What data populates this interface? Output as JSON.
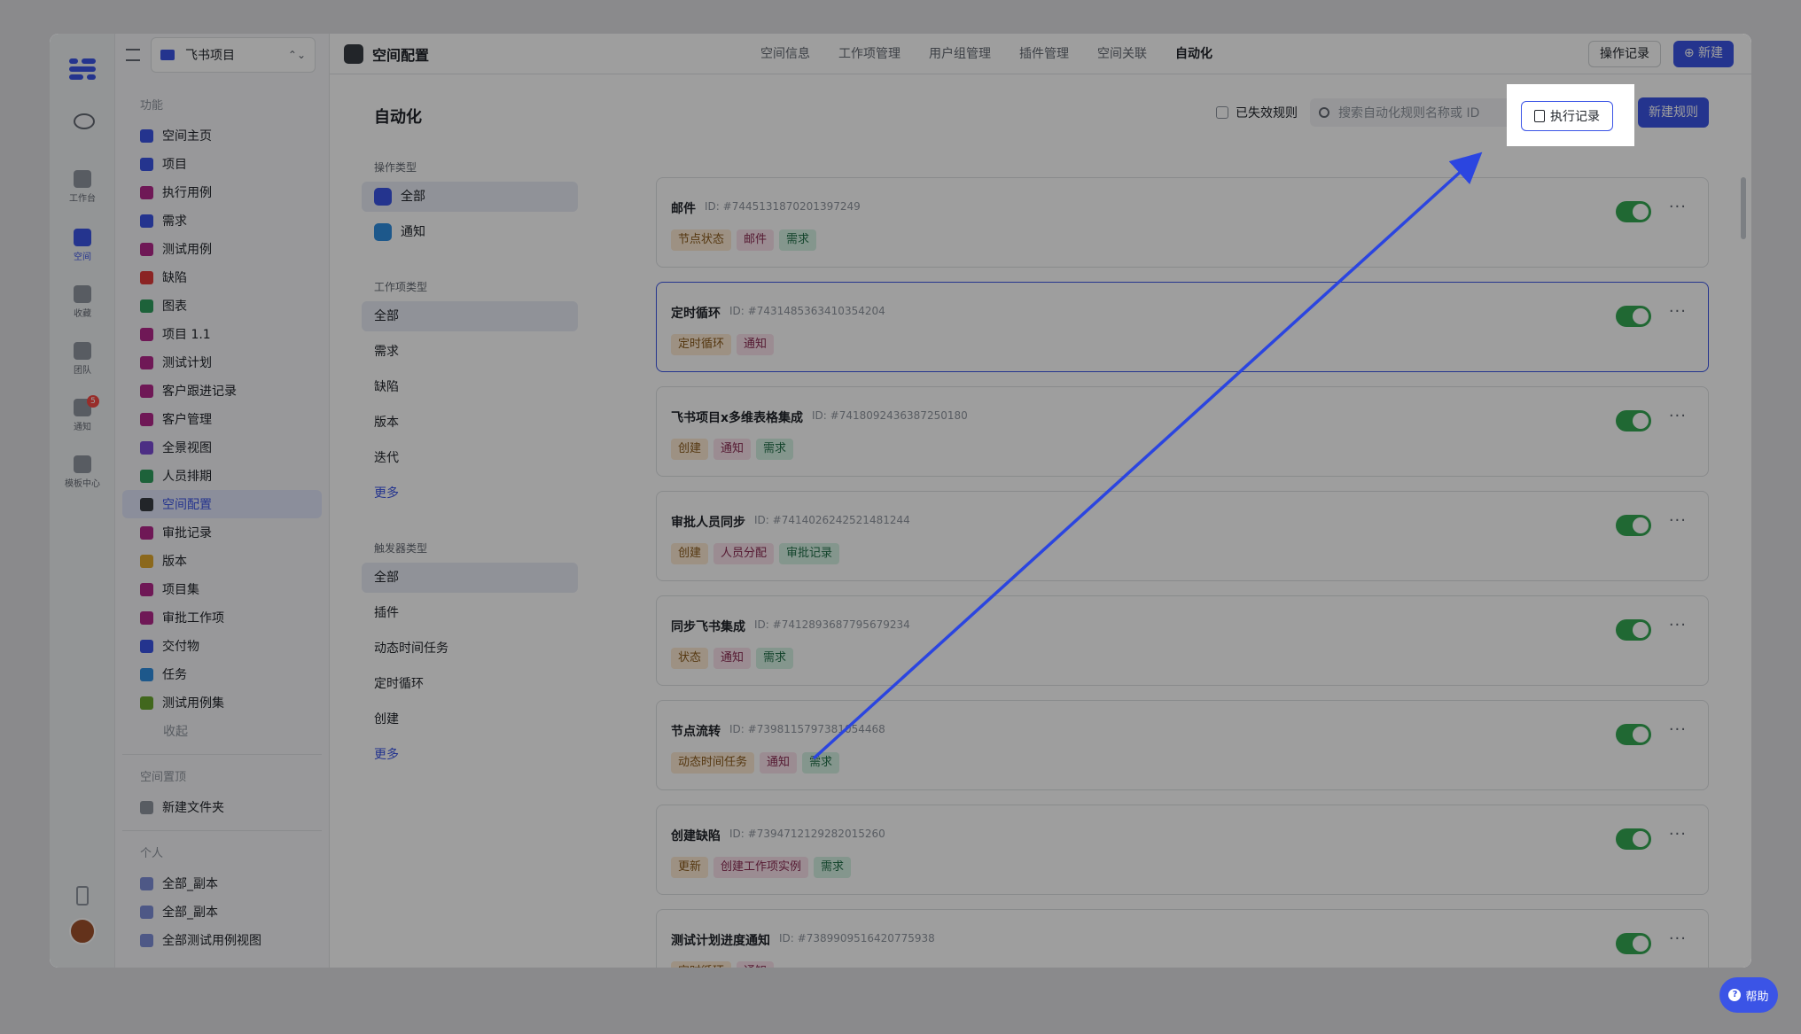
{
  "nav": {
    "project": "飞书项目",
    "section_features": "功能",
    "items": [
      {
        "label": "空间主页",
        "color": "#3b54e6"
      },
      {
        "label": "项目",
        "color": "#3b54e6"
      },
      {
        "label": "执行用例",
        "color": "#b4288c"
      },
      {
        "label": "需求",
        "color": "#3b54e6"
      },
      {
        "label": "测试用例",
        "color": "#b4288c"
      },
      {
        "label": "缺陷",
        "color": "#e03b3b"
      },
      {
        "label": "图表",
        "color": "#2f9e5e"
      },
      {
        "label": "项目 1.1",
        "color": "#b4288c"
      },
      {
        "label": "测试计划",
        "color": "#b4288c"
      },
      {
        "label": "客户跟进记录",
        "color": "#b4288c"
      },
      {
        "label": "客户管理",
        "color": "#b4288c"
      },
      {
        "label": "全景视图",
        "color": "#7b4bd6"
      },
      {
        "label": "人员排期",
        "color": "#2f9e5e"
      },
      {
        "label": "空间配置",
        "color": "#373c43"
      },
      {
        "label": "审批记录",
        "color": "#b4288c"
      },
      {
        "label": "版本",
        "color": "#e0a82e"
      },
      {
        "label": "项目集",
        "color": "#b4288c"
      },
      {
        "label": "审批工作项",
        "color": "#b4288c"
      },
      {
        "label": "交付物",
        "color": "#3b54e6"
      },
      {
        "label": "任务",
        "color": "#2f8ee0"
      },
      {
        "label": "测试用例集",
        "color": "#6aa62f"
      }
    ],
    "collapse": "收起",
    "section_pinned": "空间置顶",
    "new_folder": "新建文件夹",
    "section_personal": "个人",
    "personal": [
      "全部_副本",
      "全部_副本",
      "全部测试用例视图"
    ]
  },
  "rail": {
    "workbench": "工作台",
    "space": "空间",
    "favorites": "收藏",
    "team": "团队",
    "notify": "通知",
    "notify_badge": "5",
    "templates": "模板中心"
  },
  "header": {
    "title": "空间配置",
    "tabs": [
      "空间信息",
      "工作项管理",
      "用户组管理",
      "插件管理",
      "空间关联",
      "自动化"
    ],
    "op_log": "操作记录",
    "new": "新建"
  },
  "page": {
    "title": "自动化",
    "invalid_rules": "已失效规则",
    "search_placeholder": "搜索自动化规则名称或 ID",
    "exec_log": "执行记录",
    "new_rule": "新建规则",
    "help": "帮助"
  },
  "filters": {
    "op_type_title": "操作类型",
    "op_all": "全部",
    "op_notify": "通知",
    "work_type_title": "工作项类型",
    "work": [
      "全部",
      "需求",
      "缺陷",
      "版本",
      "迭代"
    ],
    "work_more": "更多",
    "trigger_title": "触发器类型",
    "trigger": [
      "全部",
      "插件",
      "动态时间任务",
      "定时循环",
      "创建"
    ],
    "trigger_more": "更多"
  },
  "rules": [
    {
      "name": "邮件",
      "id": "ID: #7445131870201397249",
      "tags": [
        [
          "节点状态",
          "a"
        ],
        [
          "邮件",
          "b"
        ],
        [
          "需求",
          "c"
        ]
      ],
      "selected": false
    },
    {
      "name": "定时循环",
      "id": "ID: #7431485363410354204",
      "tags": [
        [
          "定时循环",
          "a"
        ],
        [
          "通知",
          "b"
        ]
      ],
      "selected": true
    },
    {
      "name": "飞书项目x多维表格集成",
      "id": "ID: #7418092436387250180",
      "tags": [
        [
          "创建",
          "a"
        ],
        [
          "通知",
          "b"
        ],
        [
          "需求",
          "c"
        ]
      ],
      "selected": false
    },
    {
      "name": "审批人员同步",
      "id": "ID: #7414026242521481244",
      "tags": [
        [
          "创建",
          "a"
        ],
        [
          "人员分配",
          "b"
        ],
        [
          "审批记录",
          "c"
        ]
      ],
      "selected": false
    },
    {
      "name": "同步飞书集成",
      "id": "ID: #7412893687795679234",
      "tags": [
        [
          "状态",
          "a"
        ],
        [
          "通知",
          "b"
        ],
        [
          "需求",
          "c"
        ]
      ],
      "selected": false
    },
    {
      "name": "节点流转",
      "id": "ID: #7398115797381054468",
      "tags": [
        [
          "动态时间任务",
          "a"
        ],
        [
          "通知",
          "b"
        ],
        [
          "需求",
          "c"
        ]
      ],
      "selected": false
    },
    {
      "name": "创建缺陷",
      "id": "ID: #7394712129282015260",
      "tags": [
        [
          "更新",
          "a"
        ],
        [
          "创建工作项实例",
          "b"
        ],
        [
          "需求",
          "c"
        ]
      ],
      "selected": false
    },
    {
      "name": "测试计划进度通知",
      "id": "ID: #7389909516420775938",
      "tags": [
        [
          "定时循环",
          "a"
        ],
        [
          "通知",
          "b"
        ]
      ],
      "selected": false
    }
  ],
  "colors": {
    "accent": "#3b54e6",
    "toggle_on": "#34a853",
    "arrow": "#2b45e0"
  }
}
